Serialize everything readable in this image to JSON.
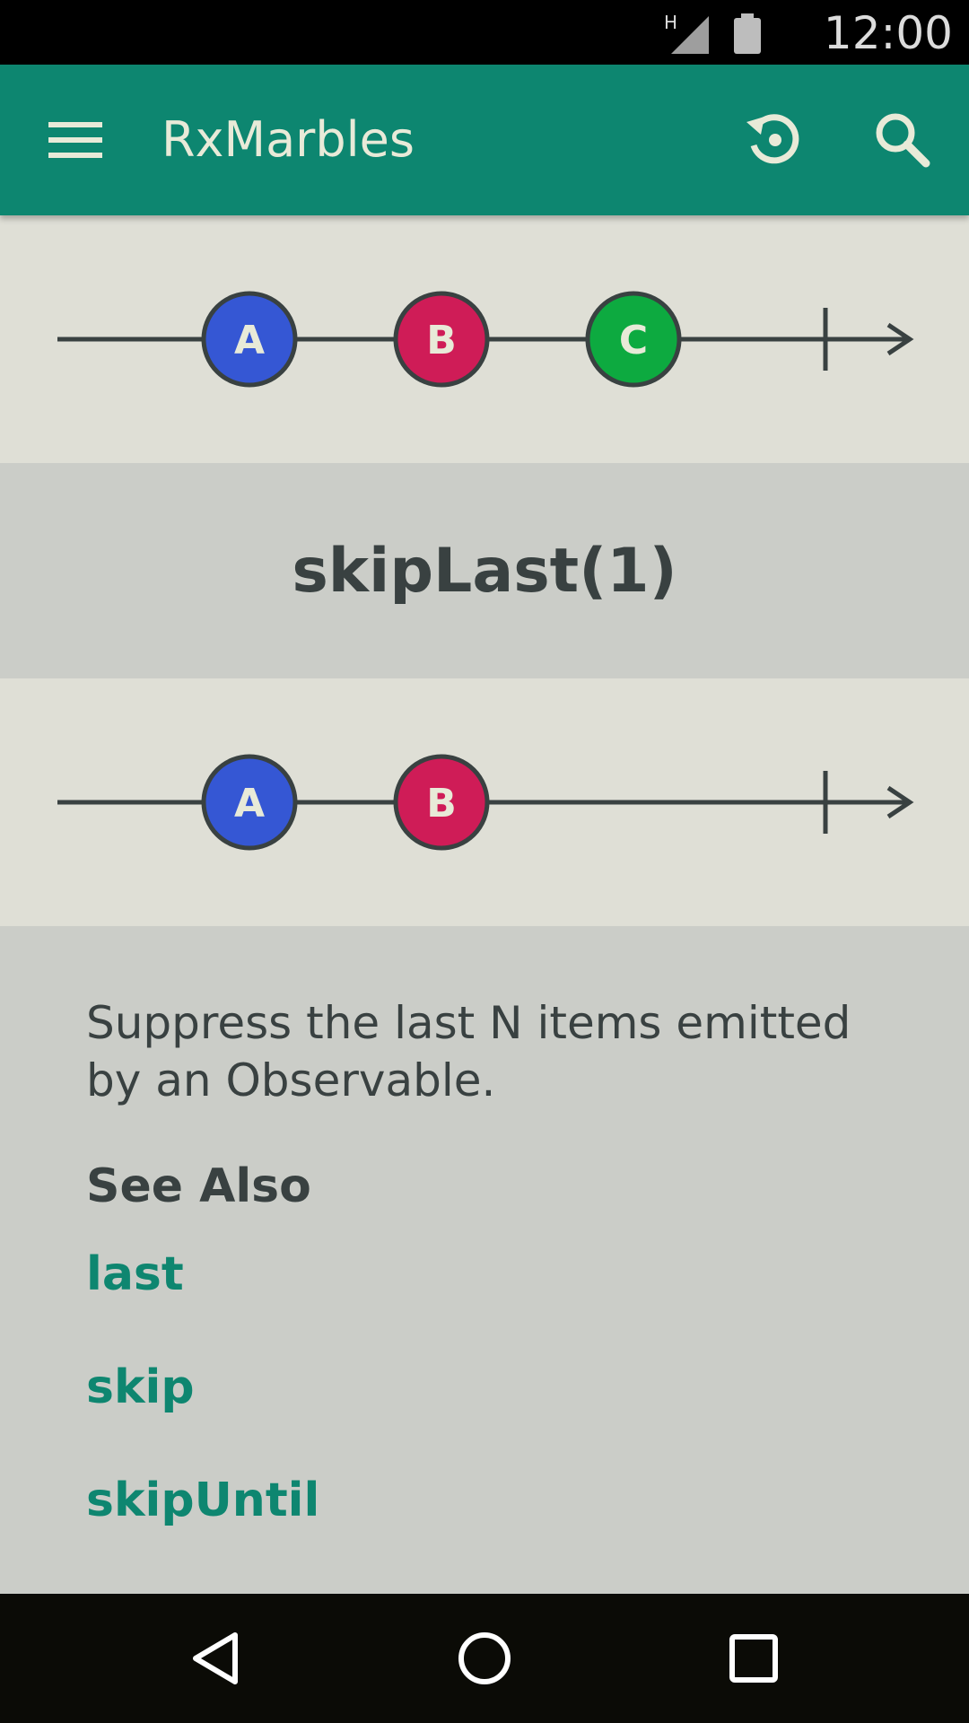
{
  "status_bar": {
    "time": "12:00",
    "network_label": "H"
  },
  "app_bar": {
    "title": "RxMarbles",
    "icons": [
      "menu-icon",
      "reset-icon",
      "search-icon"
    ]
  },
  "colors": {
    "primary": "#0d8670",
    "marble_blue": "#3557d4",
    "marble_red": "#cf1c57",
    "marble_green": "#0daa40",
    "line": "#394141"
  },
  "input_stream": {
    "marbles": [
      {
        "label": "A",
        "color": "#3557d4"
      },
      {
        "label": "B",
        "color": "#cf1c57"
      },
      {
        "label": "C",
        "color": "#0daa40"
      }
    ]
  },
  "operator": {
    "label": "skipLast(1)"
  },
  "output_stream": {
    "marbles": [
      {
        "label": "A",
        "color": "#3557d4"
      },
      {
        "label": "B",
        "color": "#cf1c57"
      }
    ]
  },
  "description": "Suppress the last N items emitted by an Observable.",
  "see_also": {
    "heading": "See Also",
    "links": [
      "last",
      "skip",
      "skipUntil"
    ]
  },
  "nav_bar": {
    "icons": [
      "back-icon",
      "home-icon",
      "recents-icon"
    ]
  }
}
